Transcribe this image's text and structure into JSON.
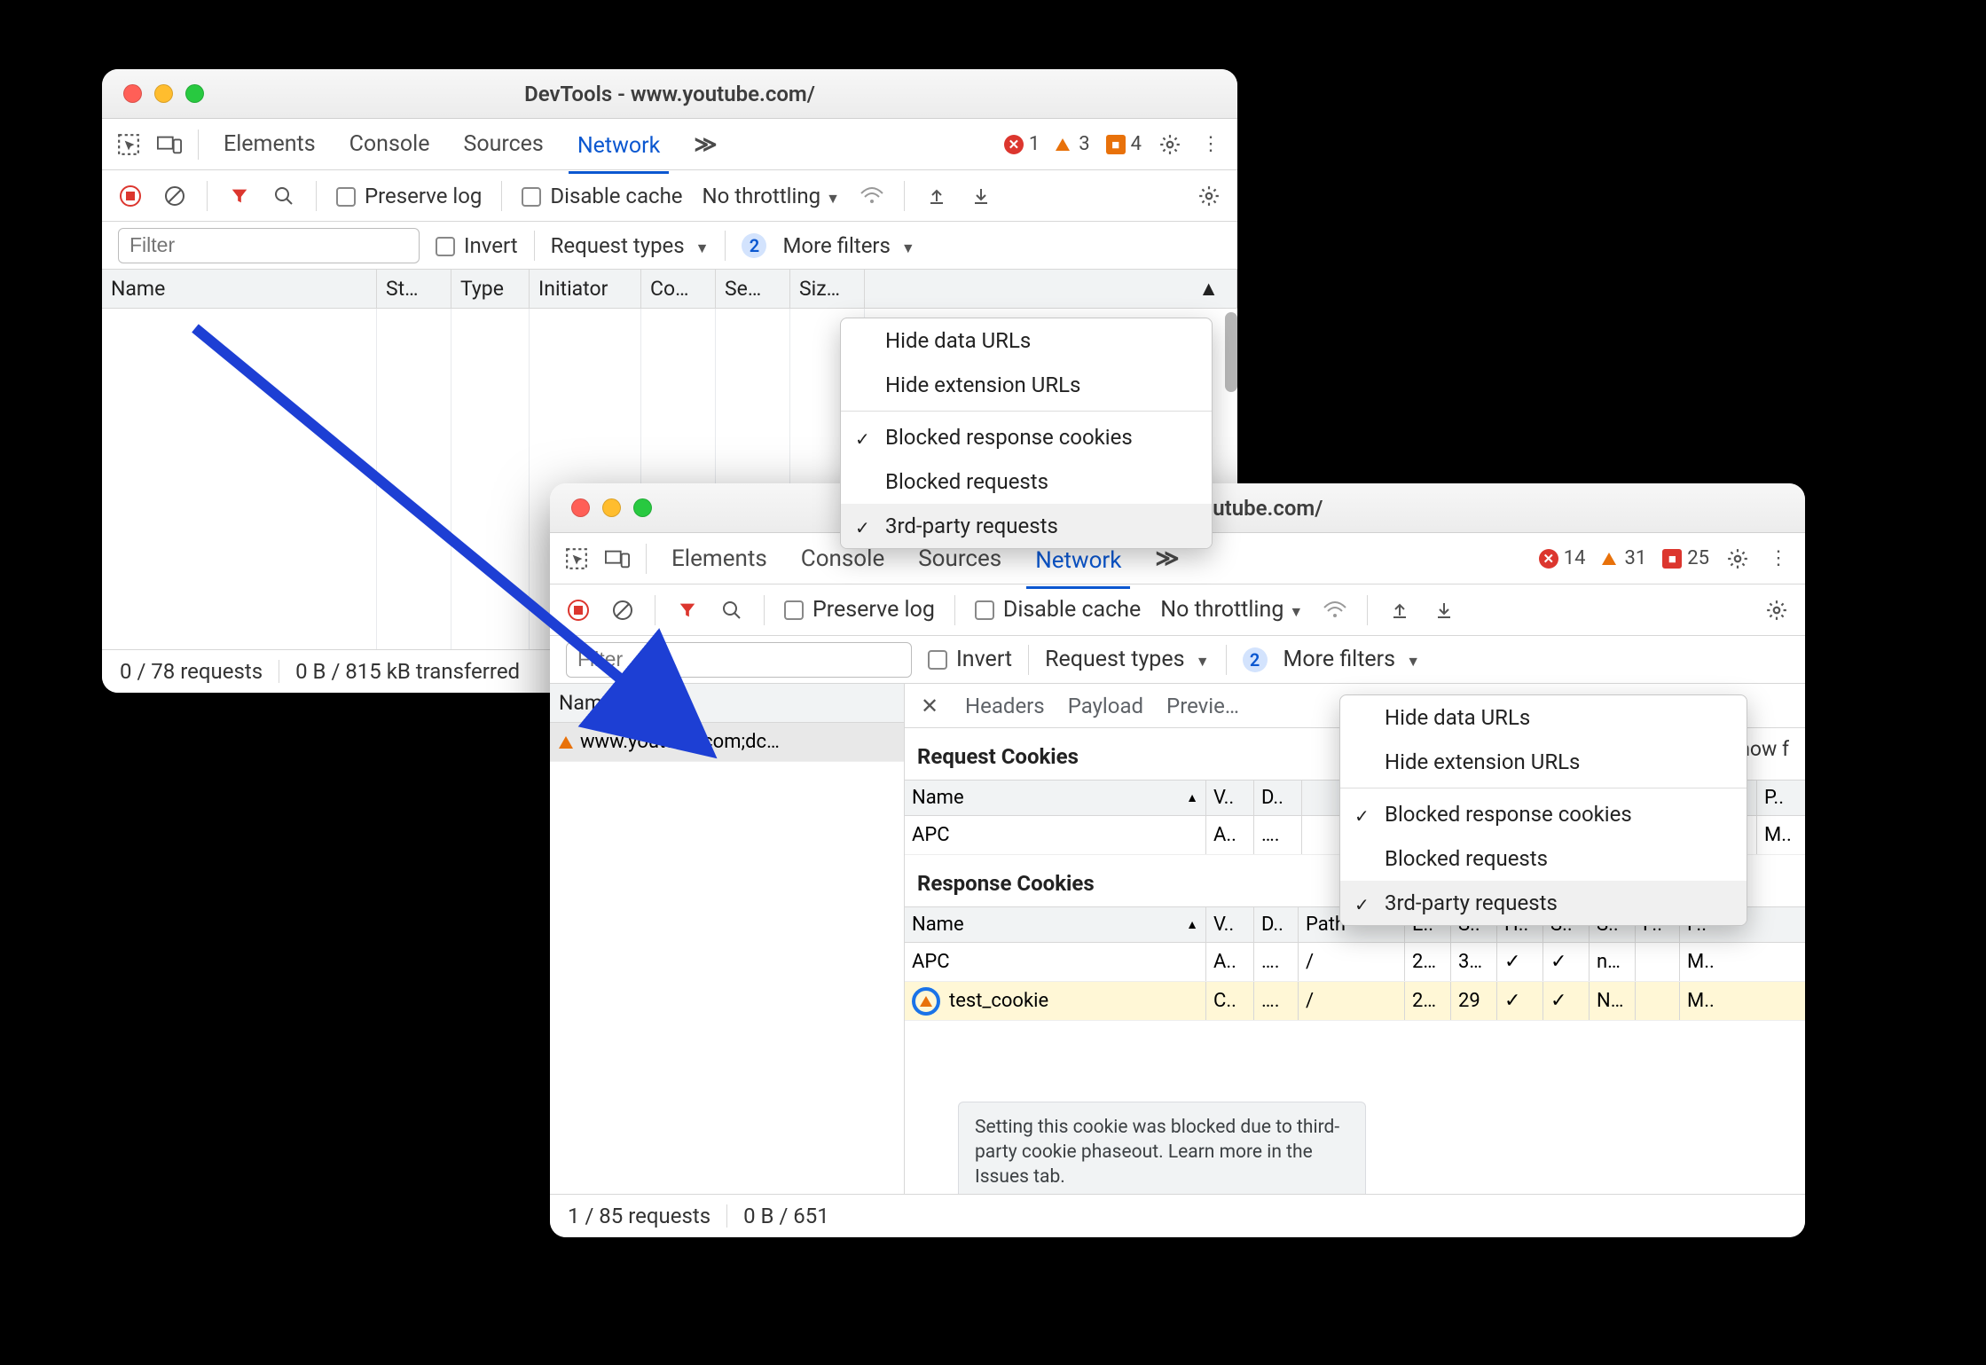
{
  "window1": {
    "title": "DevTools - www.youtube.com/",
    "tabs": [
      "Elements",
      "Console",
      "Sources",
      "Network"
    ],
    "activeTab": "Network",
    "overflow": "≫",
    "errors": {
      "red": "1",
      "orange": "3",
      "info": "4"
    },
    "toolbar": {
      "preserve": "Preserve log",
      "disable": "Disable cache",
      "throttle": "No throttling"
    },
    "filterRow": {
      "placeholder": "Filter",
      "invert": "Invert",
      "reqtypes": "Request types",
      "morefilters": "More filters",
      "badge": "2"
    },
    "columns": [
      "Name",
      "St…",
      "Type",
      "Initiator",
      "Co…",
      "Se…",
      "Siz…"
    ],
    "menu": {
      "items": [
        {
          "label": "Hide data URLs"
        },
        {
          "label": "Hide extension URLs"
        },
        {
          "sep": true
        },
        {
          "label": "Blocked response cookies",
          "checked": true
        },
        {
          "label": "Blocked requests"
        },
        {
          "label": "3rd-party requests",
          "checked": true,
          "hover": true
        }
      ]
    },
    "status": {
      "requests": "0 / 78 requests",
      "transfer": "0 B / 815 kB transferred"
    }
  },
  "window2": {
    "title": "DevTools - www.youtube.com/",
    "tabs": [
      "Elements",
      "Console",
      "Sources",
      "Network"
    ],
    "activeTab": "Network",
    "overflow": "≫",
    "errors": {
      "red": "14",
      "orange": "31",
      "info": "25"
    },
    "toolbar": {
      "preserve": "Preserve log",
      "disable": "Disable cache",
      "throttle": "No throttling"
    },
    "filterRow": {
      "placeholder": "Filter",
      "invert": "Invert",
      "reqtypes": "Request types",
      "morefilters": "More filters",
      "badge": "2"
    },
    "nameCol": "Name",
    "row0": "www.youtube.com;dc…",
    "detailsTabs": [
      "Headers",
      "Payload",
      "Previe…"
    ],
    "reqCookiesTitle": "Request Cookies",
    "showFiltered": "show f",
    "reqCookieCols": [
      "Name",
      "V..",
      "D.."
    ],
    "reqCookieExtra": [
      "..",
      "P.."
    ],
    "reqCookieRow": {
      "name": "APC",
      "v": "A..",
      "d": "….",
      "extra1": "..",
      "extra2": "M.."
    },
    "respCookiesTitle": "Response Cookies",
    "respCols": [
      "Name",
      "V..",
      "D..",
      "Path",
      "E..",
      "S..",
      "H..",
      "S..",
      "S..",
      "P..",
      "P.."
    ],
    "respRow1": {
      "name": "APC",
      "v": "A..",
      "d": "….",
      "path": "/",
      "e": "2…",
      "s": "3…",
      "h": "✓",
      "s2": "✓",
      "s3": "n…",
      "p": "",
      "p2": "M.."
    },
    "respRow2": {
      "name": "test_cookie",
      "v": "C..",
      "d": "….",
      "path": "/",
      "e": "2…",
      "s": "29",
      "h": "✓",
      "s2": "✓",
      "s3": "N…",
      "p": "",
      "p2": "M.."
    },
    "menu": {
      "items": [
        {
          "label": "Hide data URLs"
        },
        {
          "label": "Hide extension URLs"
        },
        {
          "sep": true
        },
        {
          "label": "Blocked response cookies",
          "checked": true
        },
        {
          "label": "Blocked requests"
        },
        {
          "label": "3rd-party requests",
          "checked": true,
          "hover": true
        }
      ]
    },
    "tooltip": "Setting this cookie was blocked due to third-party cookie phaseout. Learn more in the Issues tab.",
    "status": {
      "requests": "1 / 85 requests",
      "transfer": "0 B / 651"
    }
  }
}
